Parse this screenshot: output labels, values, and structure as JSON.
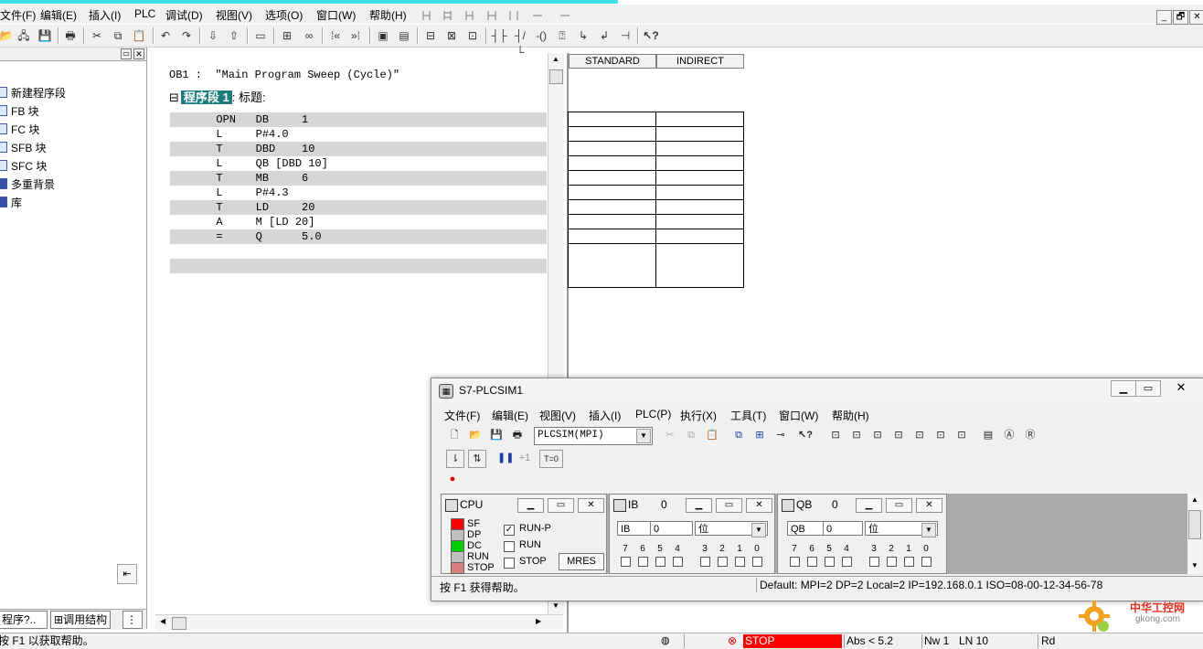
{
  "menubar": {
    "items": [
      "文件(F)",
      "编辑(E)",
      "插入(I)",
      "PLC",
      "调试(D)",
      "视图(V)",
      "选项(O)",
      "窗口(W)",
      "帮助(H)"
    ],
    "mdi_buttons": [
      "_",
      "🗗",
      "✕"
    ]
  },
  "toolbar": {
    "icons": [
      "open-folder-icon",
      "accessible-nodes-icon",
      "save-icon",
      "print-icon",
      "cut-icon",
      "copy-icon",
      "paste-icon",
      "undo-icon",
      "redo-icon",
      "download-icon",
      "upload-icon",
      "monitor-icon",
      "network-icon",
      "glasses-icon",
      "bookmark-prev-icon",
      "bookmark-next-icon",
      "overview-icon",
      "details-icon",
      "tree-icon",
      "contact-icon",
      "nc-contact-icon",
      "coil-icon",
      "box-icon",
      "branch-open-icon",
      "branch-close-icon",
      "connection-icon",
      "help-icon"
    ]
  },
  "left_panel": {
    "items": [
      "新建程序段",
      "FB 块",
      "FC 块",
      "SFB 块",
      "SFC 块",
      "多重背景",
      "库"
    ],
    "tabs": [
      "程序?..",
      "调用结构"
    ]
  },
  "editor": {
    "block_title": "OB1 :  \"Main Program Sweep (Cycle)\"",
    "network_label": "程序段 1",
    "network_title": ": 标题:",
    "collapse_icon": "⊟",
    "code": [
      "       OPN   DB     1",
      "       L     P#4.0",
      "       T     DBD    10",
      "       L     QB [DBD 10]",
      "       T     MB     6",
      "       L     P#4.3",
      "       T     LD     20",
      "       A     M [LD 20]",
      "       =     Q      5.0"
    ]
  },
  "var_table": {
    "headers": [
      "STANDARD",
      "INDIRECT"
    ]
  },
  "statusbar": {
    "help": "按 F1 以获取帮助。",
    "plc_state": "STOP",
    "abs": "Abs < 5.2",
    "nw": "Nw 1",
    "ln": "LN 10",
    "mode": "Rd"
  },
  "plcsim": {
    "title": "S7-PLCSIM1",
    "menu": [
      "文件(F)",
      "编辑(E)",
      "视图(V)",
      "插入(I)",
      "PLC(P)",
      "执行(X)",
      "工具(T)",
      "窗口(W)",
      "帮助(H)"
    ],
    "connection": "PLCSIM(MPI)",
    "step_label": "+1",
    "timer_label": "T=0",
    "cpu": {
      "title": "CPU",
      "leds": [
        {
          "label": "SF",
          "color": "#ff0000"
        },
        {
          "label": "DP",
          "color": "#c0c0c0"
        },
        {
          "label": "DC",
          "color": "#00cc00"
        },
        {
          "label": "RUN",
          "color": "#c0c0c0"
        },
        {
          "label": "STOP",
          "color": "#d88080"
        }
      ],
      "modes": [
        {
          "label": "RUN-P",
          "checked": true
        },
        {
          "label": "RUN",
          "checked": false
        },
        {
          "label": "STOP",
          "checked": false
        }
      ],
      "mres": "MRES"
    },
    "ib": {
      "title": "IB",
      "number": "0",
      "field": "IB",
      "value": "0",
      "format": "位",
      "bits": [
        "7",
        "6",
        "5",
        "4",
        "3",
        "2",
        "1",
        "0"
      ]
    },
    "qb": {
      "title": "QB",
      "number": "0",
      "field": "QB",
      "value": "0",
      "format": "位",
      "bits": [
        "7",
        "6",
        "5",
        "4",
        "3",
        "2",
        "1",
        "0"
      ]
    },
    "status_help": "按 F1 获得帮助。",
    "status_info": "Default:  MPI=2 DP=2 Local=2 IP=192.168.0.1 ISO=08-00-12-34-56-78"
  },
  "watermark": {
    "cn": "中华工控网",
    "url": "gkong.com"
  }
}
